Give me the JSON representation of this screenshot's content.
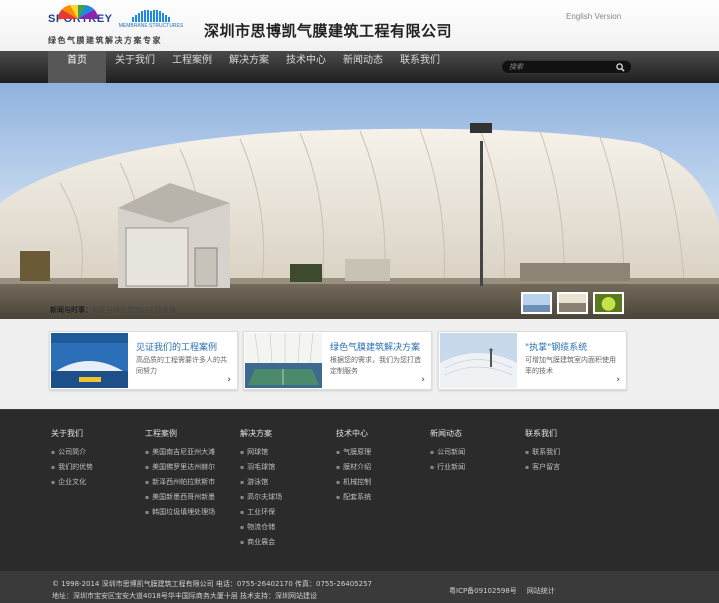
{
  "header": {
    "logo_brand": "SPORTKEY",
    "logo_sub": "MEMBRANE STRUCTURES",
    "slogan": "绿色气膜建筑解决方案专家",
    "company_name": "深圳市思博凯气膜建筑工程有限公司",
    "english_link": "English Version"
  },
  "nav": {
    "items": [
      "首页",
      "关于我们",
      "工程案例",
      "解决方案",
      "技术中心",
      "新闻动态",
      "联系我们"
    ],
    "active_index": 0,
    "search_placeholder": "搜索"
  },
  "banner": {
    "caption_label": "新闻与时事：",
    "caption_text": "智能与绿色建筑的全球发展"
  },
  "features": [
    {
      "title": "见证我们的工程案例",
      "desc": "高品质的工程需要许多人的共同努力",
      "icon": "chevron-right-icon"
    },
    {
      "title": "绿色气膜建筑解决方案",
      "desc": "根据您的需求，我们为您打造定制服务",
      "icon": "chevron-right-icon"
    },
    {
      "title": "\"执掌\"钢缆系统",
      "desc": "可增加气膜建筑室内面积使用率的技术",
      "icon": "chevron-right-icon"
    }
  ],
  "footer": {
    "columns": [
      {
        "title": "关于我们",
        "links": [
          "公司简介",
          "我们的优势",
          "企业文化"
        ]
      },
      {
        "title": "工程案例",
        "links": [
          "美国南吉尼亚州大滩",
          "美国佛罗里达州赫尔",
          "新泽西州帕拉默斯市",
          "美国新墨西哥州新墨",
          "韩国垃圾填埋处理场"
        ]
      },
      {
        "title": "解决方案",
        "links": [
          "网球馆",
          "羽毛球馆",
          "游泳馆",
          "高尔夫球场",
          "工业环保",
          "物流仓储",
          "商业展会"
        ]
      },
      {
        "title": "技术中心",
        "links": [
          "气膜原理",
          "膜材介绍",
          "机械控制",
          "配套系统"
        ]
      },
      {
        "title": "新闻动态",
        "links": [
          "公司新闻",
          "行业新闻"
        ]
      },
      {
        "title": "联系我们",
        "links": [
          "联系我们",
          "客户留言"
        ]
      }
    ],
    "copyright_line1": "© 1998-2014 深圳市思博凯气膜建筑工程有限公司  电话：0755-26402170  传真：0755-26405257",
    "copyright_line2": "地址：深圳市宝安区宝安大道4018号华丰国际商务大厦十层   技术支持：深圳网站建设",
    "icp": "粤ICP备09102598号",
    "stats": "网站统计"
  },
  "colors": {
    "nav_bg": "#2b2b2b",
    "accent_blue": "#2a6fb0",
    "footer_bg": "#2b2b2b"
  }
}
